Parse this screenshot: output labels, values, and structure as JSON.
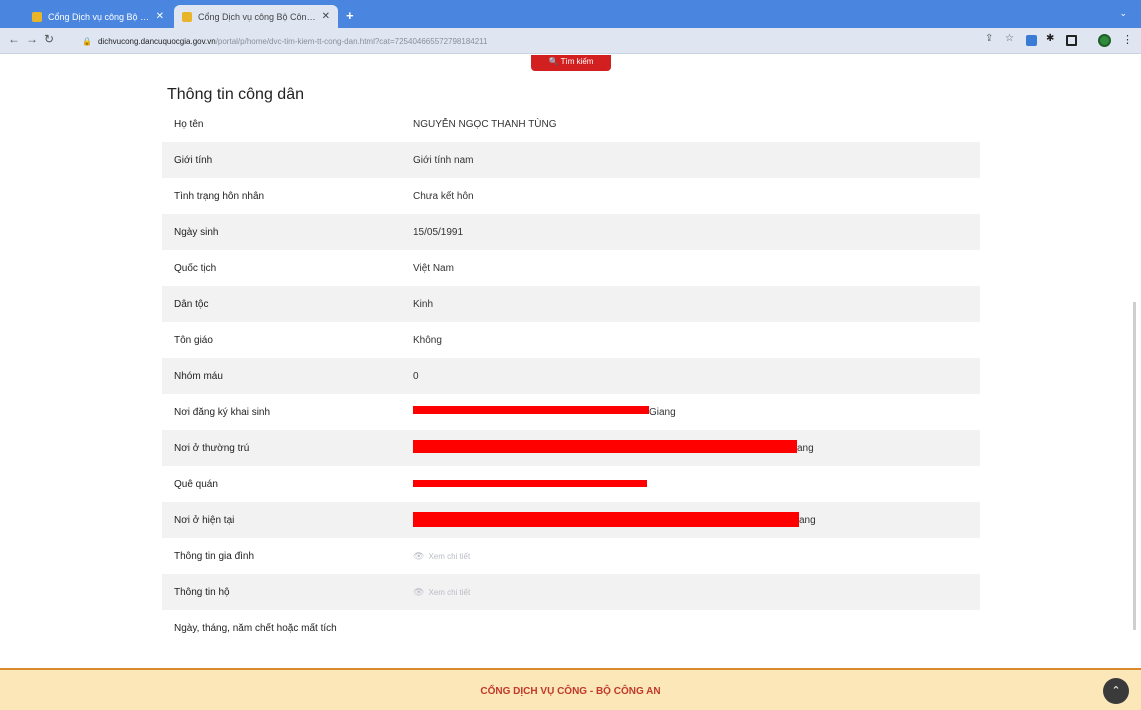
{
  "browser": {
    "tabs": [
      {
        "label": "Cổng Dịch vụ công Bộ Công A",
        "active": false
      },
      {
        "label": "Cổng Dịch vụ công Bộ Công A",
        "active": true
      }
    ],
    "url_host": "dichvucong.dancuquocgia.gov.vn",
    "url_path": "/portal/p/home/dvc-tim-kiem-tt-cong-dan.html?cat=725404665572798184211"
  },
  "page": {
    "search_button": "Tìm kiếm",
    "section_title": "Thông tin công dân",
    "rows": [
      {
        "label": "Họ tên",
        "value": "NGUYỄN NGỌC THANH TÙNG"
      },
      {
        "label": "Giới tính",
        "value": "Giới tính nam"
      },
      {
        "label": "Tình trạng hôn nhân",
        "value": "Chưa kết hôn"
      },
      {
        "label": "Ngày sinh",
        "value": "15/05/1991"
      },
      {
        "label": "Quốc tịch",
        "value": "Việt Nam"
      },
      {
        "label": "Dân tộc",
        "value": "Kinh"
      },
      {
        "label": "Tôn giáo",
        "value": "Không"
      },
      {
        "label": "Nhóm máu",
        "value": "0"
      },
      {
        "label": "Nơi đăng ký khai sinh",
        "value": "Giang"
      },
      {
        "label": "Nơi ở thường trú",
        "value": "ang"
      },
      {
        "label": "Quê quán",
        "value": ""
      },
      {
        "label": "Nơi ở hiện tại",
        "value": "ang"
      },
      {
        "label": "Thông tin gia đình",
        "value": "Xem chi tiết"
      },
      {
        "label": "Thông tin hộ",
        "value": "Xem chi tiết"
      },
      {
        "label": "Ngày, tháng, năm chết hoặc mất tích",
        "value": ""
      }
    ]
  },
  "footer": {
    "text": "CỔNG DỊCH VỤ CÔNG - BỘ CÔNG AN"
  },
  "colors": {
    "tab_bar": "#4a86e0",
    "search_button": "#d21f1f",
    "redaction": "#ff0000",
    "footer_bg": "#fbe7b8",
    "footer_text": "#c0392b"
  }
}
